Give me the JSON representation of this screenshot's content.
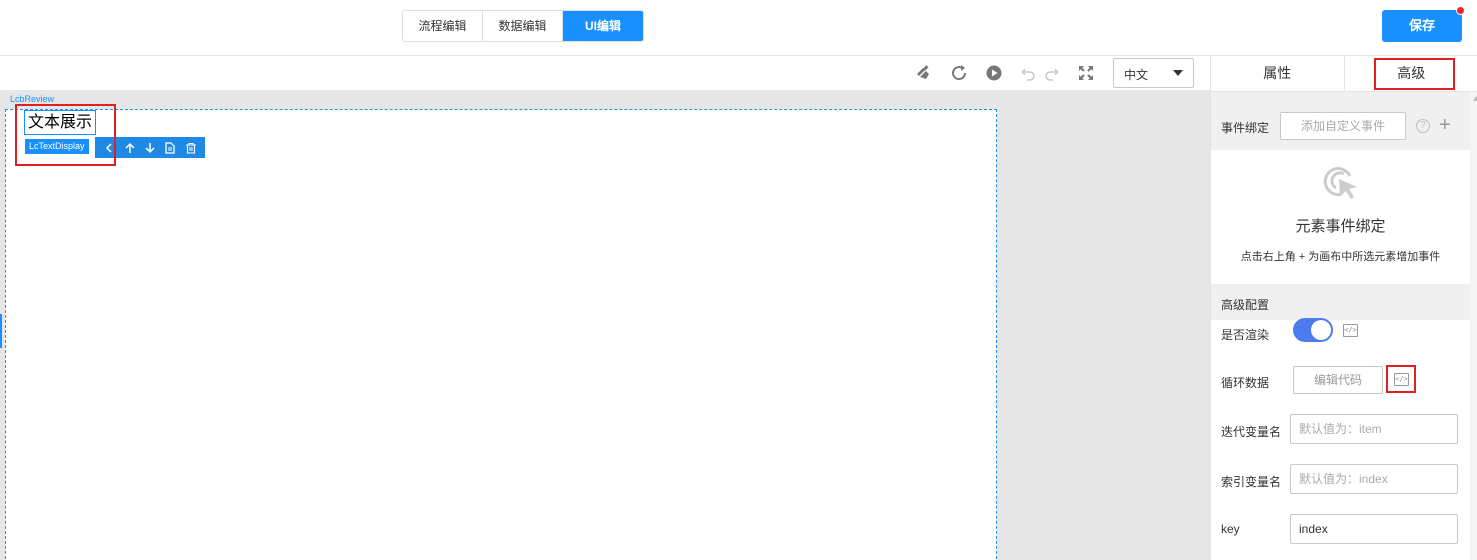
{
  "header": {
    "mode_tabs": [
      {
        "label": "流程编辑",
        "active": false
      },
      {
        "label": "数据编辑",
        "active": false
      },
      {
        "label": "UI编辑",
        "active": true
      }
    ],
    "save_label": "保存"
  },
  "toolbar": {
    "icons": [
      "clean-icon",
      "refresh-icon",
      "play-icon",
      "undo-icon",
      "redo-icon",
      "fullscreen-icon"
    ],
    "language": "中文"
  },
  "canvas": {
    "root_label": "LcbReview",
    "selected_text": "文本展示",
    "selected_component": "LcTextDisplay",
    "actions": [
      "select-parent-icon",
      "move-up-icon",
      "move-down-icon",
      "copy-icon",
      "delete-icon"
    ]
  },
  "panel": {
    "tabs": [
      {
        "label": "属性",
        "active": false
      },
      {
        "label": "高级",
        "active": true
      }
    ],
    "event_binding": {
      "label": "事件绑定",
      "add_button": "添加自定义事件",
      "help": "?",
      "plus": "+",
      "empty_title": "元素事件绑定",
      "empty_desc": "点击右上角 + 为画布中所选元素增加事件"
    },
    "advanced": {
      "section_title": "高级配置",
      "render_label": "是否渲染",
      "render_on": true,
      "loop_label": "循环数据",
      "loop_button": "编辑代码",
      "iter_label": "迭代变量名",
      "iter_placeholder": "默认值为：item",
      "index_label": "索引变量名",
      "index_placeholder": "默认值为：index",
      "key_label": "key",
      "key_value": "index",
      "code_glyph": "</>"
    }
  }
}
